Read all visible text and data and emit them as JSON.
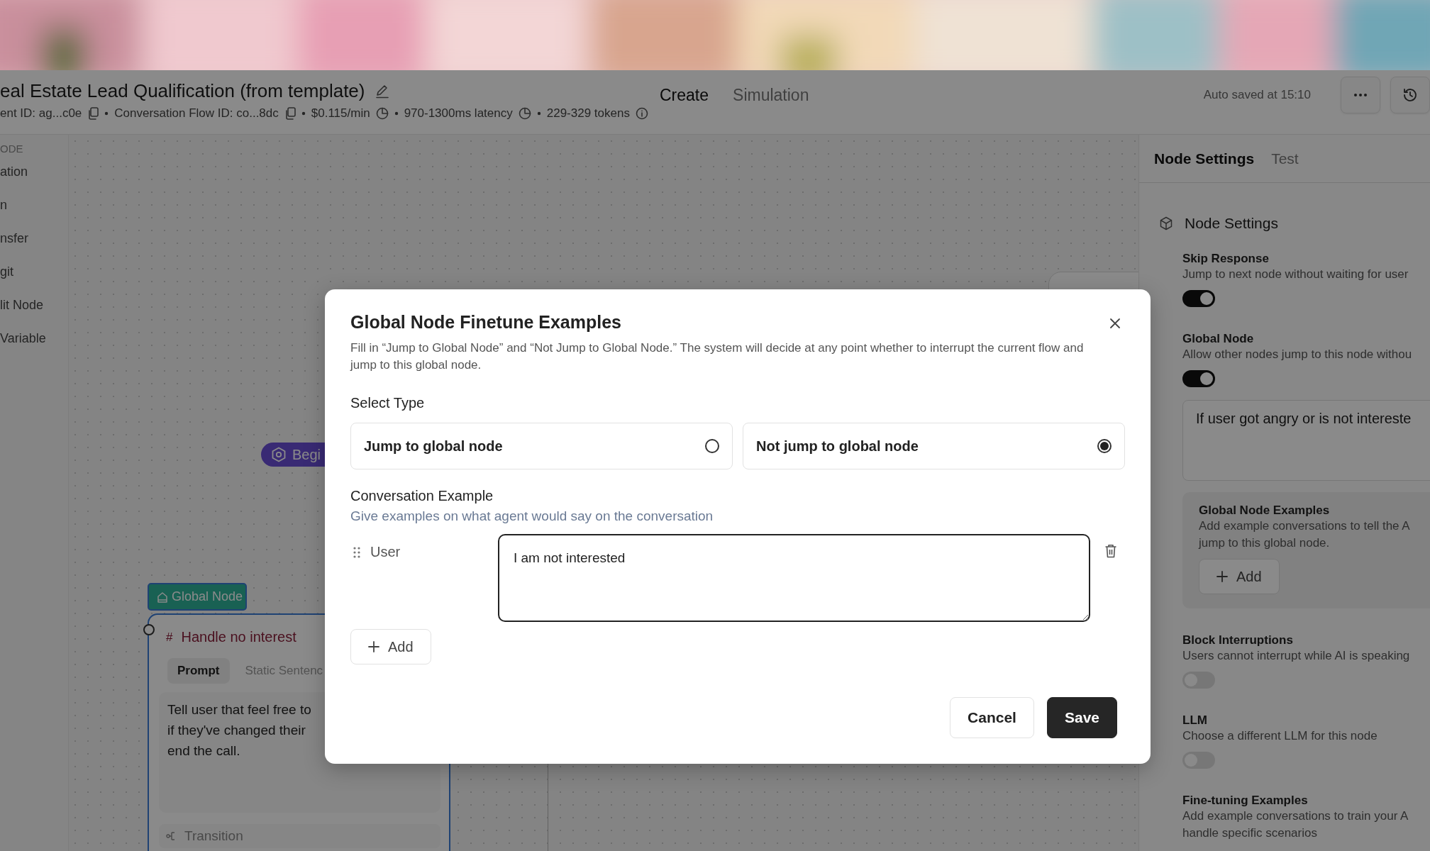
{
  "header": {
    "title": "eal Estate Lead Qualification (from template)",
    "meta": [
      {
        "text": "ent ID: ag...c0e",
        "kind": "copyable"
      },
      {
        "text": "Conversation Flow ID: co...8dc",
        "kind": "copyable"
      },
      {
        "text": "$0.115/min",
        "kind": "metric"
      },
      {
        "text": "970-1300ms latency",
        "kind": "metric"
      },
      {
        "text": "229-329 tokens",
        "kind": "estimate"
      }
    ],
    "tabs": [
      {
        "label": "Create",
        "selected": true
      },
      {
        "label": "Simulation",
        "selected": false
      }
    ],
    "autosave": "Auto saved at 15:10"
  },
  "sidebar": {
    "heading": "ODE",
    "items": [
      "ation",
      "n",
      "nsfer",
      "git",
      "lit Node",
      "Variable"
    ]
  },
  "canvas": {
    "begin_node": {
      "label": "Begi"
    },
    "global_node": {
      "tag": "Global Node",
      "mark": "#",
      "title": "Handle no interest",
      "tabs": [
        {
          "label": "Prompt",
          "selected": true
        },
        {
          "label": "Static Sentenc",
          "selected": false
        }
      ],
      "prompt": [
        "Tell user that feel free to",
        "if they've changed their",
        "end the call."
      ],
      "transition": "Transition"
    }
  },
  "panel": {
    "tabs": [
      {
        "label": "Node Settings",
        "selected": true
      },
      {
        "label": "Test",
        "selected": false
      }
    ],
    "section_title": "Node Settings",
    "settings": [
      {
        "kind": "toggle",
        "label": "Skip Response",
        "description": [
          "Jump to next node without waiting for user"
        ],
        "on": true
      },
      {
        "kind": "toggle",
        "label": "Global Node",
        "description": [
          "Allow other nodes jump to this node withou"
        ],
        "on": true,
        "condition": "If user got angry or is not intereste",
        "examples_box": {
          "title": "Global Node Examples",
          "description": [
            "Add example conversations to tell the A",
            "jump to this global node."
          ],
          "add": "Add"
        }
      },
      {
        "kind": "toggle",
        "label": "Block Interruptions",
        "description": [
          "Users cannot interrupt while AI is speaking"
        ],
        "on": false
      },
      {
        "kind": "toggle",
        "label": "LLM",
        "description": [
          "Choose a different LLM for this node"
        ],
        "on": false
      },
      {
        "kind": "info",
        "label": "Fine-tuning Examples",
        "description": [
          "Add example conversations to train your A",
          "handle specific scenarios"
        ]
      }
    ]
  },
  "modal": {
    "title": "Global Node Finetune Examples",
    "description": "Fill in “Jump to Global Node” and “Not Jump to Global Node.” The system will decide at any point whether to interrupt the current flow and jump to this global node.",
    "select_type_label": "Select Type",
    "options": [
      {
        "label": "Jump to global node",
        "selected": false
      },
      {
        "label": "Not jump to global node",
        "selected": true
      }
    ],
    "example_heading": "Conversation Example",
    "example_description": "Give examples on what agent would say on the conversation",
    "examples": [
      {
        "role": "User",
        "text": "I am not interested\n"
      }
    ],
    "add_label": "Add",
    "buttons": [
      {
        "label": "Cancel",
        "kind": "secondary"
      },
      {
        "label": "Save",
        "kind": "primary"
      }
    ]
  }
}
